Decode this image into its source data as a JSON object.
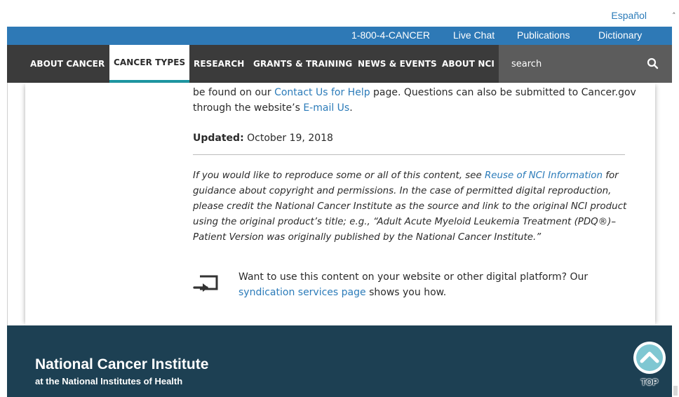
{
  "header": {
    "language_link": "Español",
    "utility": {
      "phone": "1-800-4-CANCER",
      "live_chat": "Live Chat",
      "publications": "Publications",
      "dictionary": "Dictionary"
    },
    "nav": {
      "items": [
        "ABOUT CANCER",
        "CANCER TYPES",
        "RESEARCH",
        "GRANTS & TRAINING",
        "NEWS & EVENTS",
        "ABOUT NCI"
      ],
      "active": "CANCER TYPES"
    },
    "search": {
      "placeholder": "search"
    }
  },
  "content": {
    "contact_line_1_pre": "be found on our ",
    "contact_link": "Contact Us for Help",
    "contact_line_1_post": " page. Questions can also be submitted to Cancer.gov",
    "contact_line_2_pre": "through the website’s ",
    "email_link": "E-mail Us",
    "contact_line_2_post": ".",
    "updated_label": "Updated:",
    "updated_date": " October 19, 2018",
    "reuse_pre": "If you would like to reproduce some or all of this content, see ",
    "reuse_link": "Reuse of NCI Information",
    "reuse_post": " for guidance about copyright and permissions. In the case of permitted digital reproduction, please credit the National Cancer Institute as the source and link to the original NCI product using the original product’s title; e.g., “Adult Acute Myeloid Leukemia Treatment (PDQ®)–Patient Version was originally published by the National Cancer Institute.”",
    "syndication_pre": "Want to use this content on your website or other digital platform? Our ",
    "syndication_link": "syndication services page",
    "syndication_post": " shows you how."
  },
  "footer": {
    "title": "National Cancer Institute",
    "subtitle": "at the National Institutes of Health",
    "top_label": "TOP"
  },
  "colors": {
    "utility_bar": "#2e79b6",
    "nav_bar": "#3b3b3b",
    "active_underline": "#1f9aa6",
    "link": "#2b7bb9",
    "footer": "#1d4053",
    "top_button": "#7fc7d2"
  },
  "icons": [
    "search-icon",
    "syndication-icon",
    "back-to-top-icon"
  ]
}
